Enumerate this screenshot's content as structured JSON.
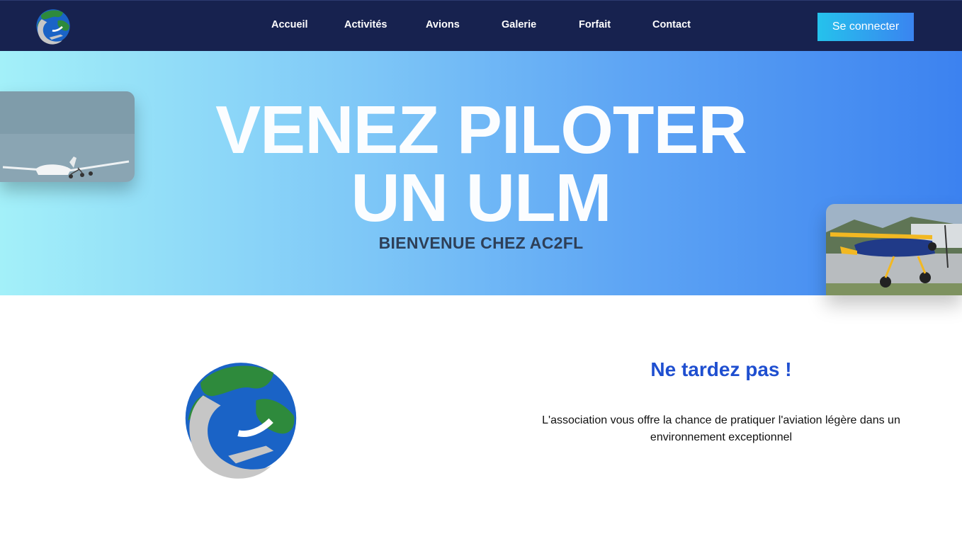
{
  "nav": {
    "logo_icon": "globe-airplane-logo",
    "links": [
      "Accueil",
      "Activités",
      "Avions",
      "Galerie",
      "Forfait",
      "Contact"
    ],
    "login_label": "Se connecter",
    "colors": {
      "background": "#17224f",
      "button_start": "#25c2ec",
      "button_end": "#3a84f0"
    }
  },
  "hero": {
    "title_line1": "VENEZ PILOTER",
    "title_line2": "UN ULM",
    "subtitle": "BIENVENUE CHEZ AC2FL",
    "photo_left": "ulm-glider-in-flight-photo",
    "photo_right": "yellow-ulm-on-ground-photo",
    "colors": {
      "gradient_start": "#a3f0f9",
      "gradient_end": "#3c82f0"
    }
  },
  "intro": {
    "logo_icon": "globe-airplane-logo",
    "title": "Ne tardez pas !",
    "text": "L'association vous offre la chance de pratiquer l'aviation légère dans un environnement exceptionnel",
    "title_color": "#1f4fd0"
  }
}
